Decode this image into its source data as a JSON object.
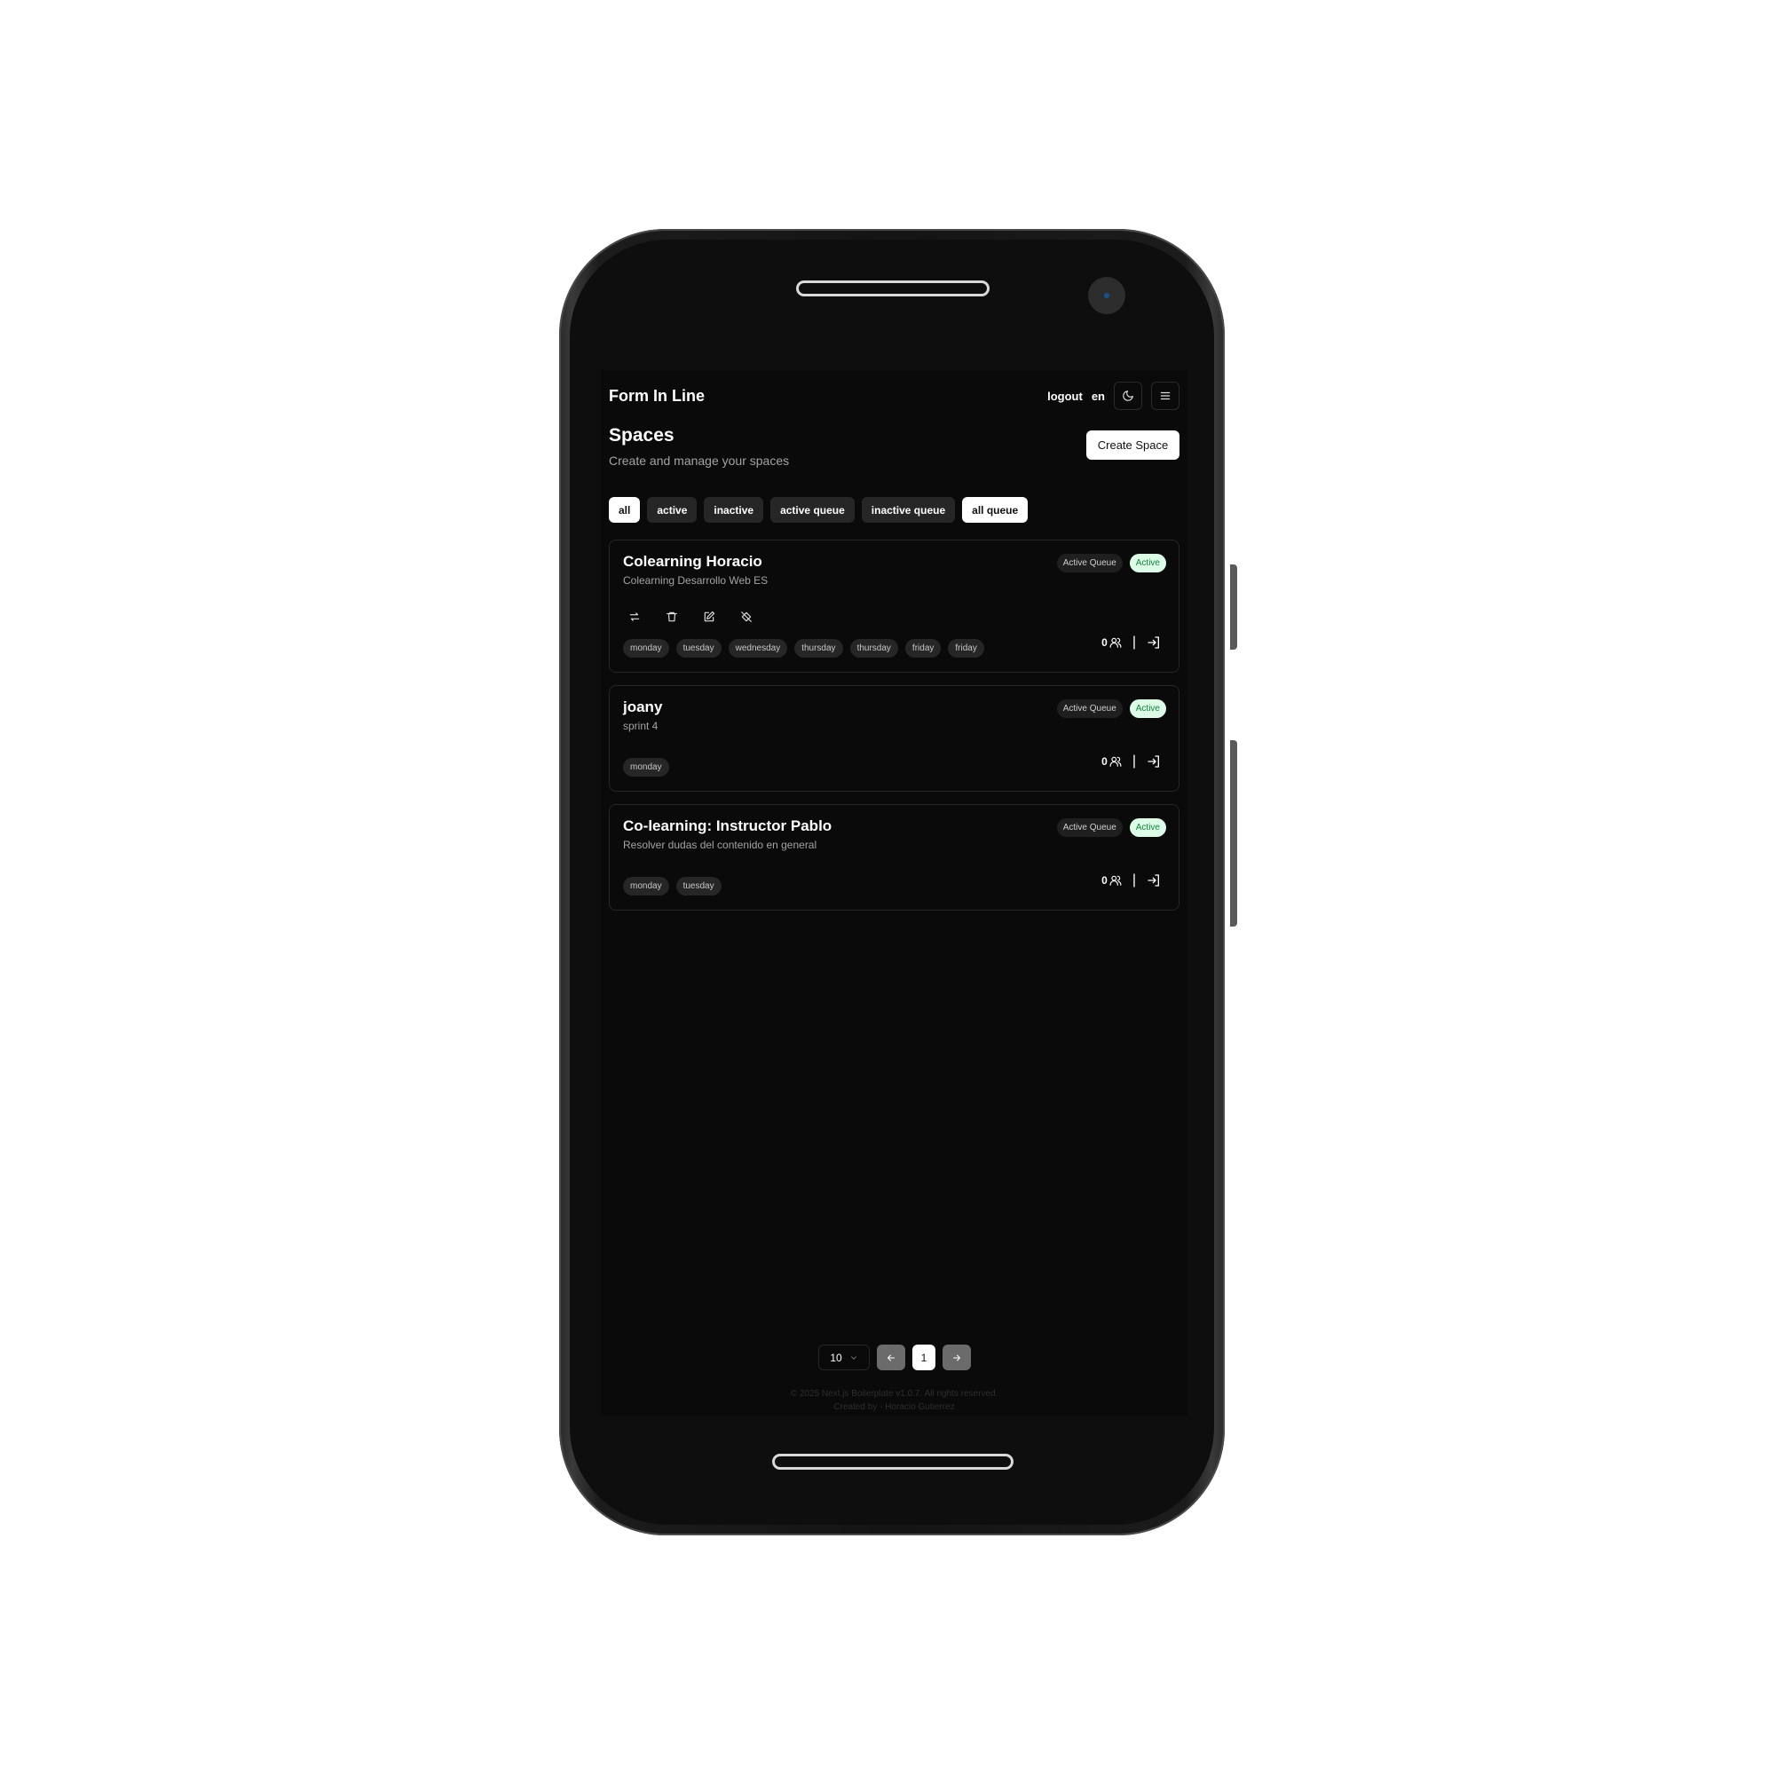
{
  "app": {
    "brand": "Form In Line",
    "nav": {
      "logout": "logout",
      "language": "en"
    }
  },
  "header": {
    "title": "Spaces",
    "subtitle": "Create and manage your spaces",
    "create_button": "Create Space"
  },
  "filters": [
    {
      "label": "all",
      "selected": true
    },
    {
      "label": "active",
      "selected": false
    },
    {
      "label": "inactive",
      "selected": false
    },
    {
      "label": "active queue",
      "selected": false
    },
    {
      "label": "inactive queue",
      "selected": false
    },
    {
      "label": "all queue",
      "selected": true
    }
  ],
  "spaces": [
    {
      "title": "Colearning Horacio",
      "description": "Colearning Desarrollo Web ES",
      "queue_badge": "Active Queue",
      "status_badge": "Active",
      "days": [
        "monday",
        "tuesday",
        "wednesday",
        "thursday",
        "thursday",
        "friday",
        "friday"
      ],
      "count": "0"
    },
    {
      "title": "joany",
      "description": "sprint 4",
      "queue_badge": "Active Queue",
      "status_badge": "Active",
      "days": [
        "monday"
      ],
      "count": "0"
    },
    {
      "title": "Co-learning: Instructor Pablo",
      "description": "Resolver dudas del contenido en general",
      "queue_badge": "Active Queue",
      "status_badge": "Active",
      "days": [
        "monday",
        "tuesday"
      ],
      "count": "0"
    }
  ],
  "pagination": {
    "page_size": "10",
    "current_page": "1"
  },
  "footer": {
    "line1": "© 2025 Next.js Boilerplate v1.0.7. All rights reserved.",
    "line2": "Created by - Horacio Gutierrez"
  },
  "colors": {
    "status_active_bg": "#dcfce7",
    "status_active_text": "#15803d",
    "background": "#0a0a0a"
  }
}
